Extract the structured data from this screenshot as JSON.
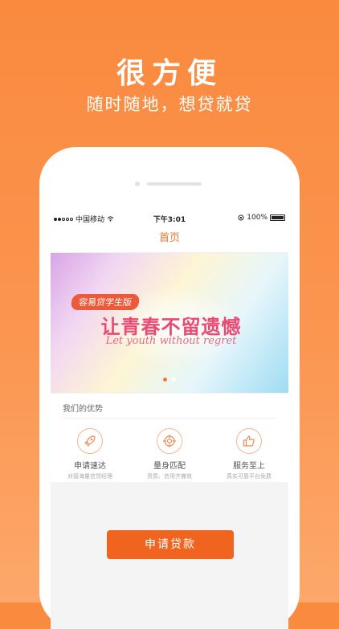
{
  "promo": {
    "headline": "很方便",
    "subline": "随时随地，想贷就贷"
  },
  "statusbar": {
    "carrier": "中国移动",
    "time": "下午3:01",
    "battery": "100%"
  },
  "navbar": {
    "title": "首页"
  },
  "banner": {
    "tag": "容易贷学生版",
    "slogan": "让青春不留遗憾",
    "slogan_en": "Let youth without regret",
    "active_slide": 1,
    "slide_count": 2
  },
  "advantages": {
    "title": "我们的优势",
    "items": [
      {
        "label": "申请速达",
        "desc": "对接海量信贷经理",
        "icon": "rocket-icon"
      },
      {
        "label": "量身匹配",
        "desc": "资质、信用齐兼效",
        "icon": "target-icon"
      },
      {
        "label": "服务至上",
        "desc": "真实可靠平台免费",
        "icon": "thumbs-up-icon"
      }
    ]
  },
  "apply_button": {
    "label": "申请贷款"
  },
  "colors": {
    "accent": "#f0641f",
    "nav_title": "#f0752c",
    "background": "#fa8c43"
  }
}
